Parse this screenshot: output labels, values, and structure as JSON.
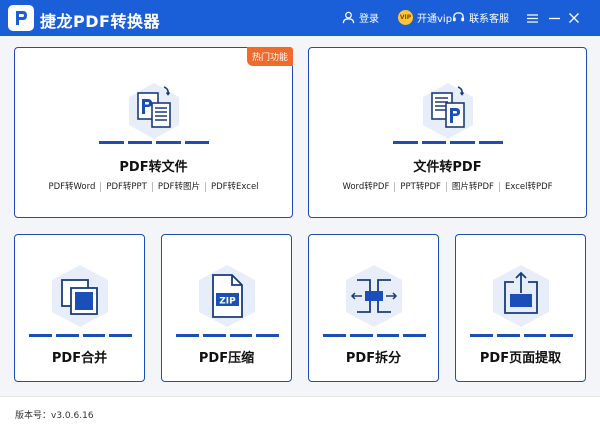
{
  "app": {
    "title": "捷龙PDF转换器"
  },
  "titlebar": {
    "login": "登录",
    "vip_badge": "VIP",
    "vip": "开通vip",
    "service": "联系客服"
  },
  "big_cards": [
    {
      "title": "PDF转文件",
      "badge": "热门功能",
      "subs": [
        "PDF转Word",
        "PDF转PPT",
        "PDF转图片",
        "PDF转Excel"
      ]
    },
    {
      "title": "文件转PDF",
      "subs": [
        "Word转PDF",
        "PPT转PDF",
        "图片转PDF",
        "Excel转PDF"
      ]
    }
  ],
  "small_cards": [
    {
      "title": "PDF合并"
    },
    {
      "title": "PDF压缩",
      "icon_text": "ZIP"
    },
    {
      "title": "PDF拆分"
    },
    {
      "title": "PDF页面提取"
    }
  ],
  "footer": {
    "version": "版本号：v3.0.6.16"
  },
  "colors": {
    "primary": "#1a5fd8",
    "accent": "#f06a2b",
    "border": "#1a4fb8"
  },
  "icons": [
    "app-logo-icon",
    "user-icon",
    "vip-icon",
    "headset-icon",
    "menu-icon",
    "minimize-icon",
    "close-icon",
    "pdf-to-file-icon",
    "file-to-pdf-icon",
    "merge-icon",
    "compress-icon",
    "split-icon",
    "extract-icon"
  ]
}
